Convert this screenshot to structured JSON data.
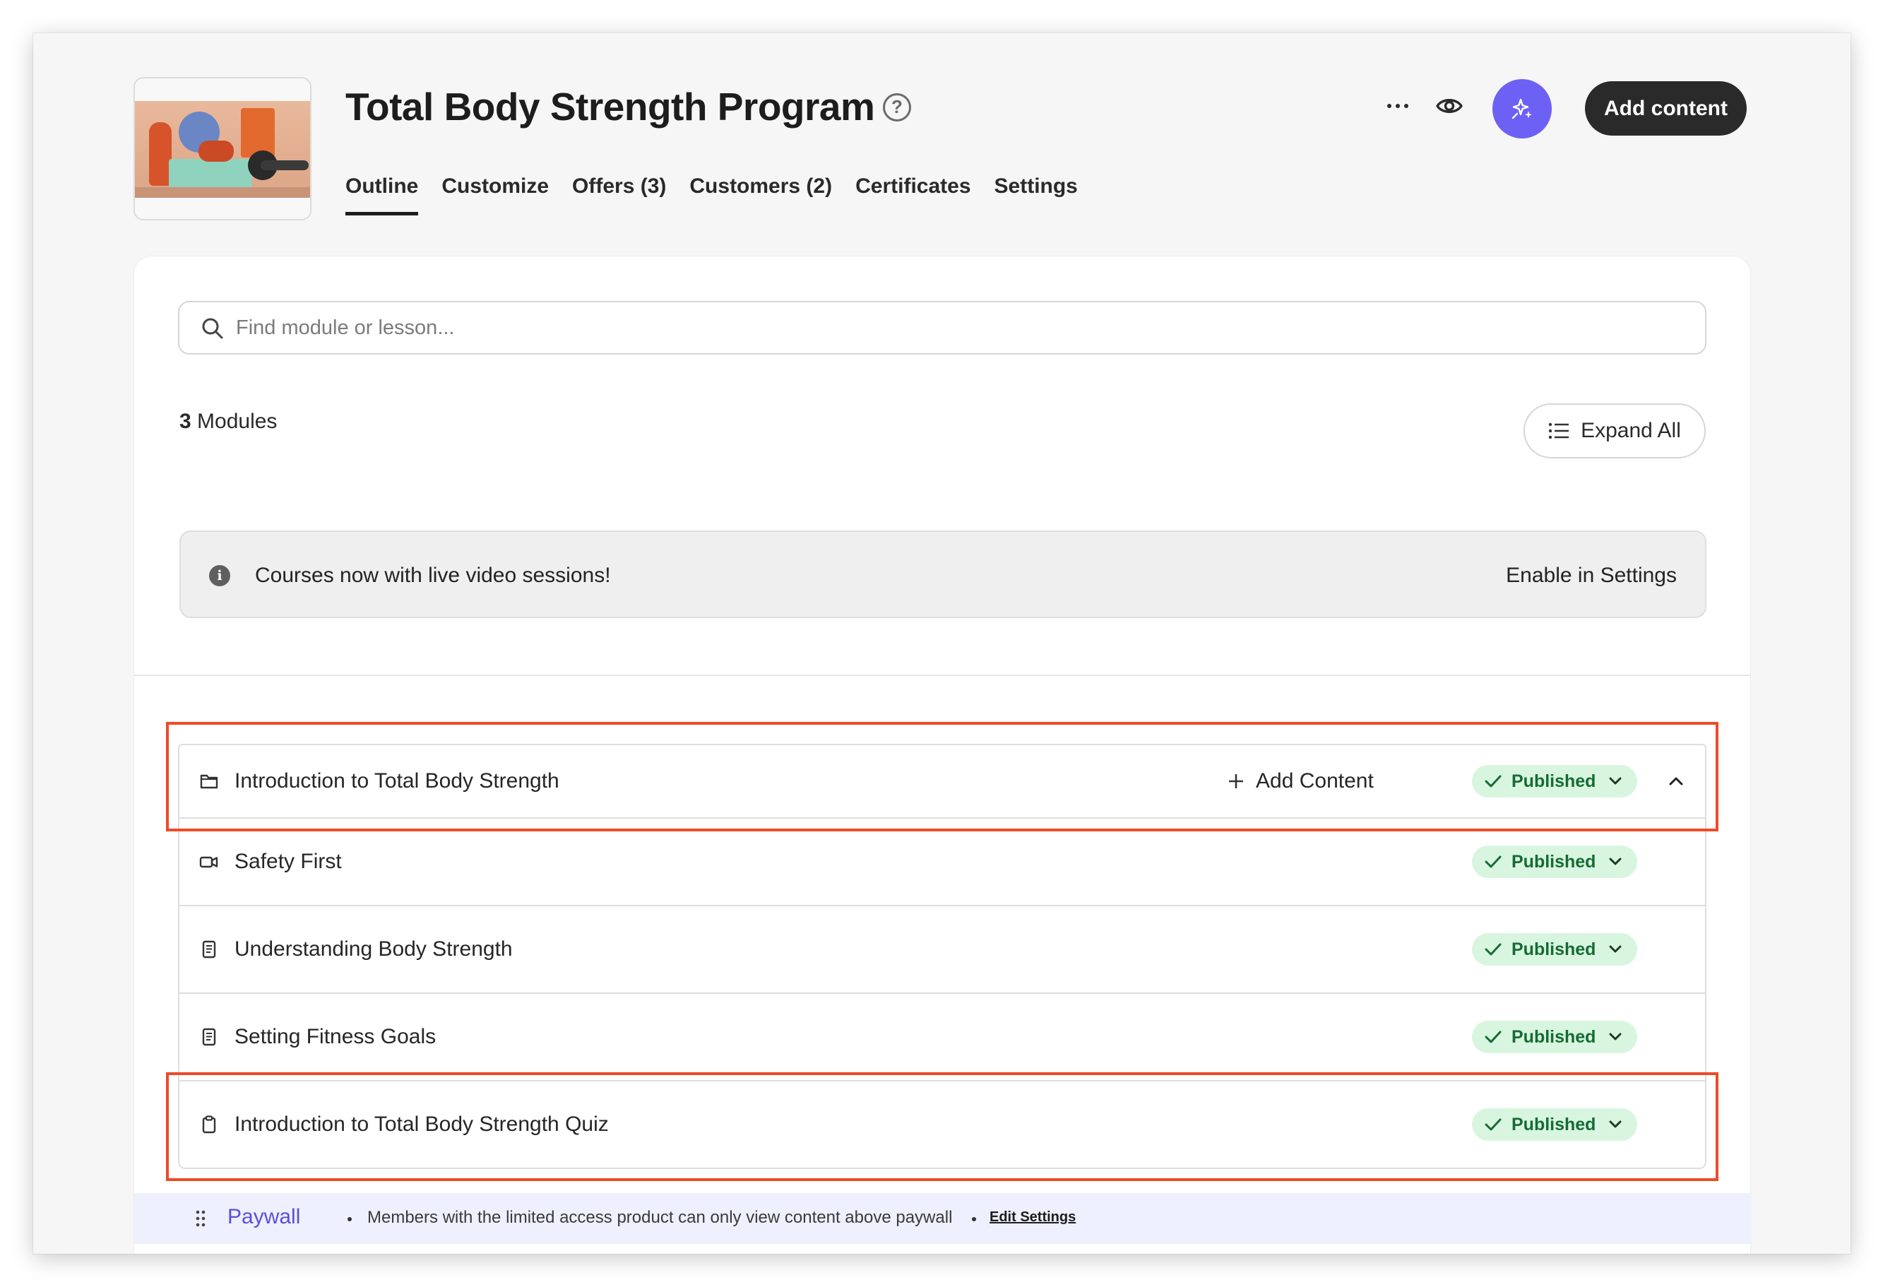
{
  "header": {
    "title": "Total Body Strength Program",
    "add_content_label": "Add content",
    "tabs": [
      {
        "label": "Outline",
        "active": true
      },
      {
        "label": "Customize"
      },
      {
        "label": "Offers (3)"
      },
      {
        "label": "Customers (2)"
      },
      {
        "label": "Certificates"
      },
      {
        "label": "Settings"
      }
    ],
    "icons": [
      "help-icon",
      "more-icon",
      "eye-icon",
      "sparkle-icon"
    ]
  },
  "search": {
    "placeholder": "Find module or lesson..."
  },
  "modules": {
    "count": "3",
    "label": " Modules",
    "expand_label": "Expand All"
  },
  "banner": {
    "text": "Courses now with live video sessions!",
    "link": "Enable in Settings"
  },
  "module": {
    "title": "Introduction to Total Body Strength",
    "add_content": "Add Content",
    "status": "Published",
    "expanded": true,
    "lessons": [
      {
        "title": "Safety First",
        "type": "video",
        "icon": "video-icon",
        "status": "Published"
      },
      {
        "title": "Understanding Body Strength",
        "type": "text",
        "icon": "document-icon",
        "status": "Published"
      },
      {
        "title": "Setting Fitness Goals",
        "type": "text",
        "icon": "document-icon",
        "status": "Published"
      },
      {
        "title": "Introduction to Total Body Strength Quiz",
        "type": "quiz",
        "icon": "clipboard-icon",
        "status": "Published"
      }
    ]
  },
  "paywall": {
    "label": "Paywall",
    "text": "Members with the limited access product can only view content above paywall",
    "link": "Edit Settings"
  },
  "colors": {
    "accent": "#6d61f5",
    "published_bg": "#d8f6df",
    "published_text": "#166b35",
    "highlight": "#ee4a2a",
    "paywall_bg": "#eef0fd"
  }
}
